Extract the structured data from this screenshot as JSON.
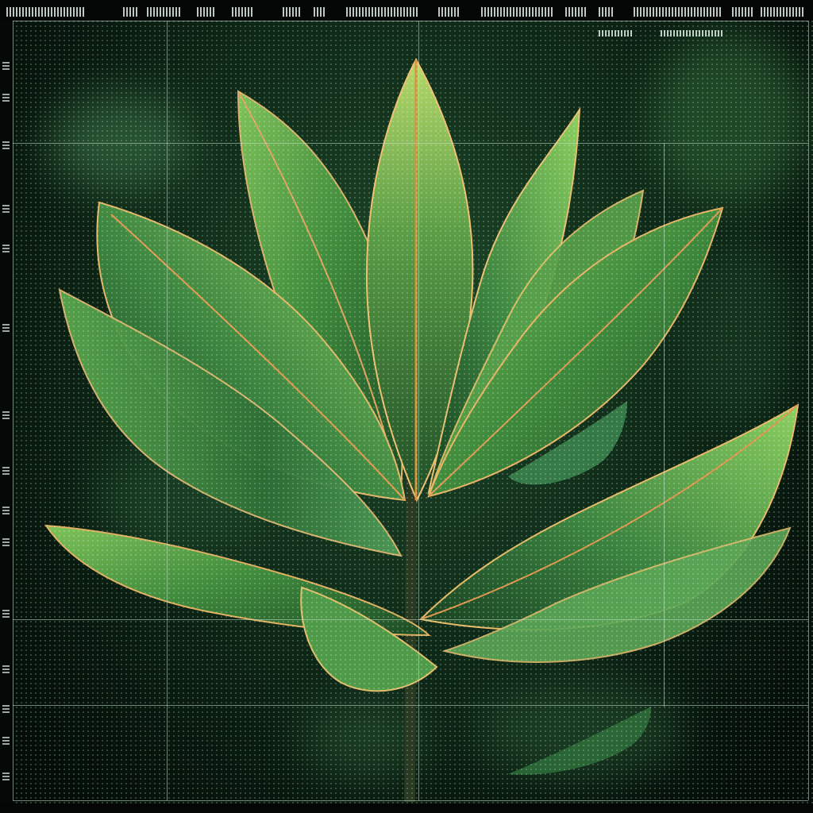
{
  "scene": {
    "subject": "leaf-plant",
    "palette": {
      "background": "#0a1410",
      "leaf_light": "#6fb04a",
      "leaf_mid": "#3e7f3a",
      "leaf_dark": "#1d4a22",
      "vein": "#e8a05a",
      "grid": "#c8e6d2"
    }
  }
}
